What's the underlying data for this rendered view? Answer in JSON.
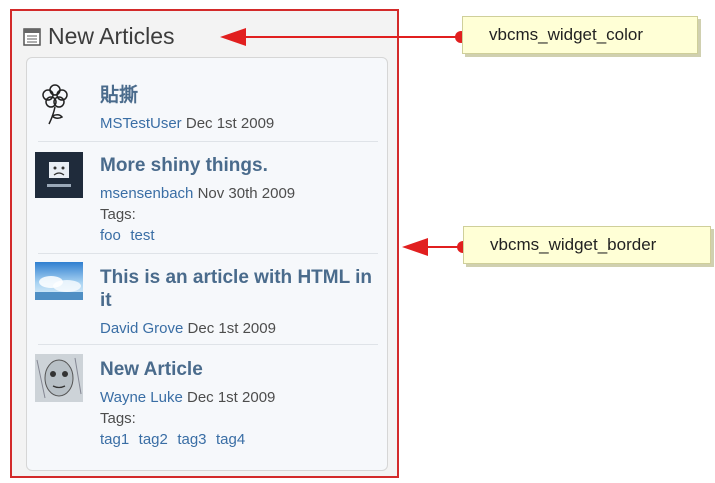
{
  "widget": {
    "title": "New Articles",
    "articles": [
      {
        "title": "貼撕",
        "author": "MSTestUser",
        "date": "Dec 1st 2009",
        "tags_label": "",
        "tags": [],
        "thumb": "flower-icon"
      },
      {
        "title": "More shiny things.",
        "author": "msensenbach",
        "date": "Nov 30th 2009",
        "tags_label": "Tags:",
        "tags": [
          "foo",
          "test"
        ],
        "thumb": "sad-computer-icon"
      },
      {
        "title": "This is an article with HTML in it",
        "author": "David Grove",
        "date": "Dec 1st 2009",
        "tags_label": "",
        "tags": [],
        "thumb": "sky-landscape-image"
      },
      {
        "title": "New Article",
        "author": "Wayne Luke",
        "date": "Dec 1st 2009",
        "tags_label": "Tags:",
        "tags": [
          "tag1",
          "tag2",
          "tag3",
          "tag4"
        ],
        "thumb": "face-portrait-image"
      }
    ]
  },
  "callouts": {
    "color_label": "vbcms_widget_color",
    "border_label": "vbcms_widget_border"
  },
  "colors": {
    "highlight": "#d32a2a",
    "arrow": "#e11f1f",
    "title_link": "#4a6b8c",
    "author_link": "#3a6ea5",
    "callout_bg": "#ffffd6"
  }
}
